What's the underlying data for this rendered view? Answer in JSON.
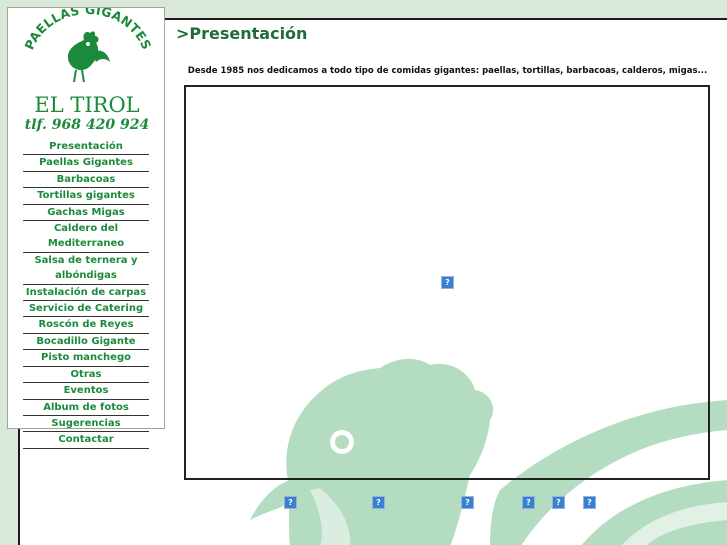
{
  "logo": {
    "arc_text": "PAELLAS GIGANTES",
    "brand": "EL TIROL",
    "phone": "tlf. 968 420 924"
  },
  "nav": [
    {
      "label": "Presentación"
    },
    {
      "label": "Paellas Gigantes"
    },
    {
      "label": "Barbacoas"
    },
    {
      "label": "Tortillas gigantes"
    },
    {
      "label": "Gachas Migas"
    },
    {
      "label": "Caldero del Mediterraneo"
    },
    {
      "label": "Salsa de ternera y albóndigas"
    },
    {
      "label": "Instalación de carpas"
    },
    {
      "label": "Servicio de Catering"
    },
    {
      "label": "Roscón de Reyes"
    },
    {
      "label": "Bocadillo Gigante"
    },
    {
      "label": "Pisto manchego"
    },
    {
      "label": "Otras"
    },
    {
      "label": "Eventos"
    },
    {
      "label": "Album de fotos"
    },
    {
      "label": "Sugerencias"
    },
    {
      "label": "Contactar"
    }
  ],
  "page": {
    "title": ">Presentación",
    "intro": "Desde 1985 nos dedicamos a todo tipo de comidas gigantes: paellas, tortillas, barbacoas, calderos, migas..."
  },
  "colors": {
    "nav_text": "#1c8a3c",
    "title": "#1f6b3a",
    "page_bg": "#d9e8d9",
    "rooster": "#b3dcc0"
  }
}
